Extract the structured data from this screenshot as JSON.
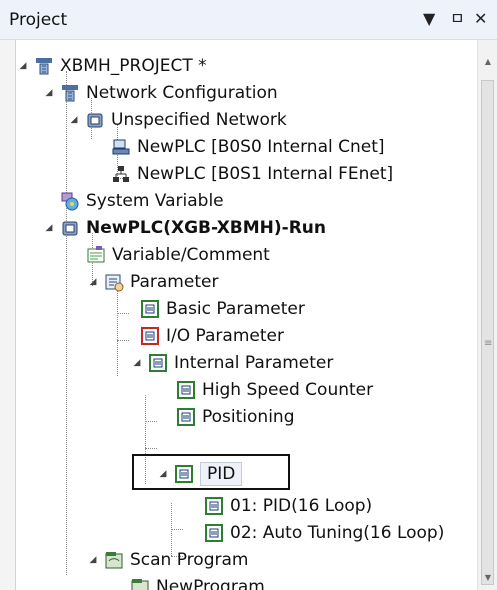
{
  "panel": {
    "title": "Project",
    "controls": [
      "▼",
      "ㅁ",
      "✕"
    ]
  },
  "tree": [
    {
      "label": "XBMH_PROJECT *",
      "icon": "project-icon",
      "expanded": true
    },
    {
      "label": "Network Configuration",
      "icon": "network-config-icon",
      "expanded": true
    },
    {
      "label": "Unspecified Network",
      "icon": "network-folder-icon",
      "expanded": true
    },
    {
      "label": "NewPLC [B0S0 Internal Cnet]",
      "icon": "cnet-icon"
    },
    {
      "label": "NewPLC [B0S1 Internal FEnet]",
      "icon": "fenet-icon"
    },
    {
      "label": "System Variable",
      "icon": "system-variable-icon"
    },
    {
      "label": "NewPLC(XGB-XBMH)-Run",
      "icon": "plc-icon",
      "expanded": true,
      "bold": true
    },
    {
      "label": "Variable/Comment",
      "icon": "variable-comment-icon"
    },
    {
      "label": "Parameter",
      "icon": "parameter-icon",
      "expanded": true
    },
    {
      "label": "Basic Parameter",
      "icon": "basic-parameter-icon"
    },
    {
      "label": "I/O Parameter",
      "icon": "io-parameter-icon"
    },
    {
      "label": "Internal Parameter",
      "icon": "internal-parameter-icon",
      "expanded": true
    },
    {
      "label": "High Speed Counter",
      "icon": "parameter-item-icon"
    },
    {
      "label": "Positioning",
      "icon": "parameter-item-icon"
    },
    {
      "label": "PID",
      "icon": "parameter-item-icon",
      "expanded": true,
      "selected": true
    },
    {
      "label": "01: PID(16 Loop)",
      "icon": "parameter-item-icon"
    },
    {
      "label": "02: Auto Tuning(16 Loop)",
      "icon": "parameter-item-icon"
    },
    {
      "label": "Scan Program",
      "icon": "scan-program-icon",
      "expanded": true
    },
    {
      "label": "NewProgram",
      "icon": "program-icon"
    }
  ]
}
